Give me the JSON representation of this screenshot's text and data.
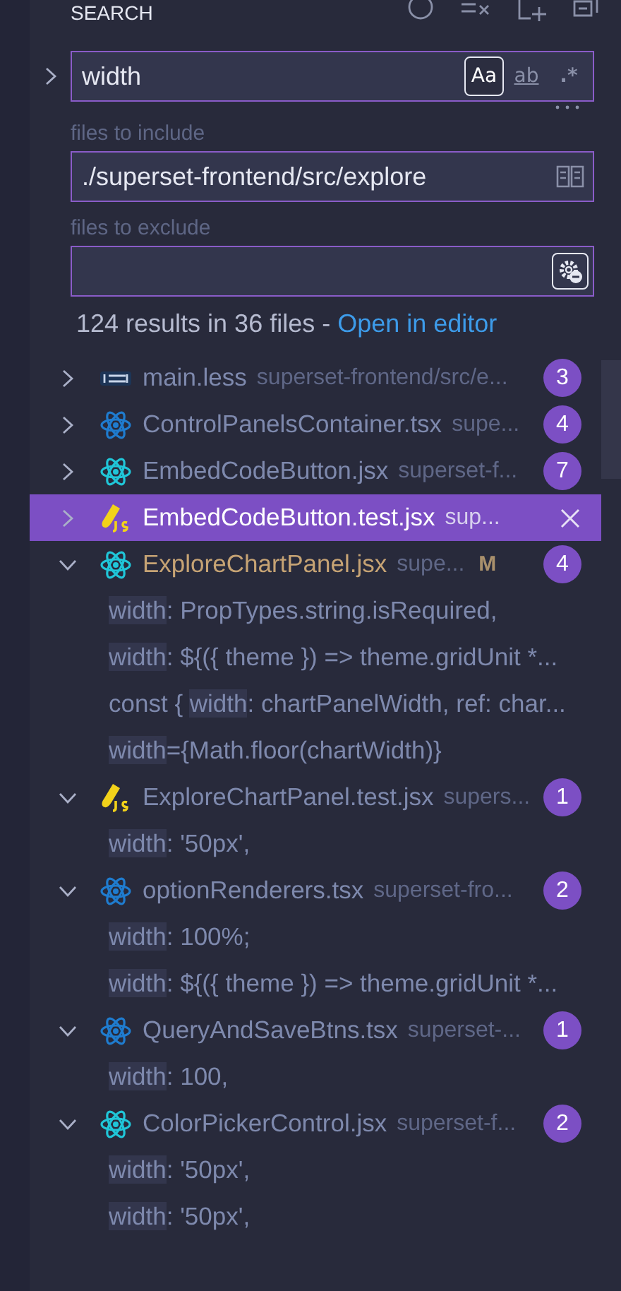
{
  "header": {
    "title": "SEARCH"
  },
  "search": {
    "value": "width",
    "toggles": [
      {
        "kind": "case",
        "label": "Aa",
        "on": true
      },
      {
        "kind": "word",
        "label": "ab",
        "on": false
      },
      {
        "kind": "regex",
        "label": ".*",
        "on": false
      }
    ]
  },
  "include": {
    "label": "files to include",
    "value": "./superset-frontend/src/explore",
    "only_open_editors": false
  },
  "exclude": {
    "label": "files to exclude",
    "use_exclude_settings": true
  },
  "summary": {
    "text": "124 results in 36 files - ",
    "link": "Open in editor"
  },
  "results": [
    {
      "kind": "less",
      "name": "main.less",
      "path": "superset-frontend/src/e...",
      "count": "3",
      "expanded": false,
      "selected": false
    },
    {
      "kind": "react-ts",
      "name": "ControlPanelsContainer.tsx",
      "path": "supe...",
      "count": "4",
      "expanded": false,
      "selected": false
    },
    {
      "kind": "react-js",
      "name": "EmbedCodeButton.jsx",
      "path": "superset-f...",
      "count": "7",
      "expanded": false,
      "selected": false
    },
    {
      "kind": "js-test",
      "name": "EmbedCodeButton.test.jsx",
      "path": "sup...",
      "expanded": false,
      "selected": true
    },
    {
      "kind": "react-js",
      "name": "ExploreChartPanel.jsx",
      "path": "supe...",
      "git_status": "M",
      "count": "4",
      "expanded": true,
      "selected": false,
      "matches": [
        {
          "hit": "width",
          "after": ": PropTypes.string.isRequired,"
        },
        {
          "hit": "width",
          "after": ": ${({ theme }) => theme.gridUnit *..."
        },
        {
          "before": "const { ",
          "hit": "width",
          "after": ": chartPanelWidth, ref: char..."
        },
        {
          "hit": "width",
          "after": "={Math.floor(chartWidth)}"
        }
      ]
    },
    {
      "kind": "js-test",
      "name": "ExploreChartPanel.test.jsx",
      "path": "supers...",
      "count": "1",
      "expanded": true,
      "selected": false,
      "matches": [
        {
          "hit": "width",
          "after": ": '50px',"
        }
      ]
    },
    {
      "kind": "react-ts",
      "name": "optionRenderers.tsx",
      "path": "superset-fro...",
      "count": "2",
      "expanded": true,
      "selected": false,
      "matches": [
        {
          "hit": "width",
          "after": ": 100%;"
        },
        {
          "hit": "width",
          "after": ": ${({ theme }) => theme.gridUnit *..."
        }
      ]
    },
    {
      "kind": "react-ts",
      "name": "QueryAndSaveBtns.tsx",
      "path": "superset-...",
      "count": "1",
      "expanded": true,
      "selected": false,
      "matches": [
        {
          "hit": "width",
          "after": ": 100,"
        }
      ]
    },
    {
      "kind": "react-js",
      "name": "ColorPickerControl.jsx",
      "path": "superset-f...",
      "count": "2",
      "expanded": true,
      "selected": false,
      "matches": [
        {
          "hit": "width",
          "after": ": '50px',"
        },
        {
          "hit": "width",
          "after": ": '50px',"
        }
      ]
    }
  ]
}
